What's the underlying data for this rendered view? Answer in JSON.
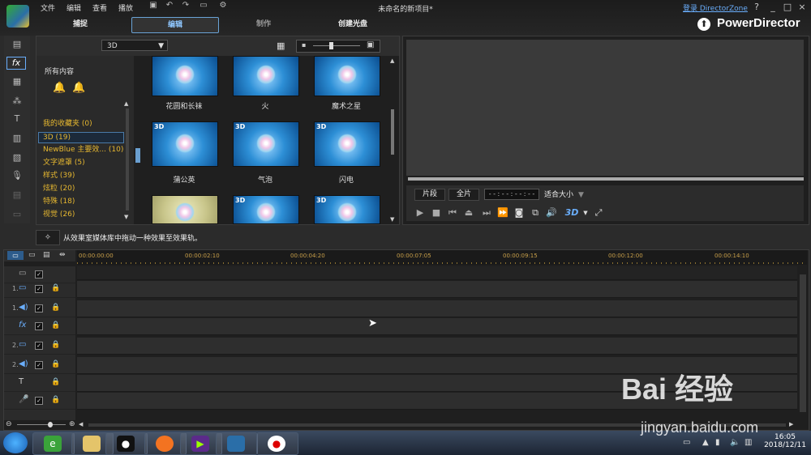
{
  "menu": [
    "文件",
    "编辑",
    "查看",
    "播放"
  ],
  "window": {
    "title": "未命名的新项目*",
    "login": "登录 DirectorZone",
    "help": "?",
    "minimize": "_",
    "maximize": "□",
    "close": "×"
  },
  "tabs": [
    "捕捉",
    "编辑",
    "制作",
    "创建光盘"
  ],
  "brand": "PowerDirector",
  "library": {
    "category_select": "3D",
    "tree_all": "所有内容",
    "tree_items": [
      "我的收藏夹 (0)",
      "3D (19)",
      "NewBlue 主要效... (10)",
      "文字遮罩 (5)",
      "样式 (39)",
      "炫粒 (20)",
      "特殊 (18)",
      "视觉 (26)"
    ],
    "effects": [
      {
        "label": "花圆和长袜",
        "tag": ""
      },
      {
        "label": "火",
        "tag": ""
      },
      {
        "label": "魔术之星",
        "tag": ""
      },
      {
        "label": "蒲公英",
        "tag": "3D"
      },
      {
        "label": "气泡",
        "tag": "3D"
      },
      {
        "label": "闪电",
        "tag": "3D"
      },
      {
        "label": "",
        "tag": "3D"
      },
      {
        "label": "",
        "tag": "3D"
      },
      {
        "label": "",
        "tag": "3D"
      }
    ]
  },
  "preview": {
    "clip": "片段",
    "full": "全片",
    "timecode": "- - : - - : - - : - -",
    "fit": "适合大小",
    "mode_3d": "3D"
  },
  "hint": "从效果室媒体库中拖动一种效果至效果轨。",
  "timeline": {
    "ruler": [
      "00:00:00:00",
      "00:00:02:10",
      "00:00:04:20",
      "00:00:07:05",
      "00:00:09:15",
      "00:00:12:00",
      "00:00:14:10"
    ],
    "tracks": [
      {
        "num": "",
        "icon": "▭"
      },
      {
        "num": "1.",
        "icon": "▭"
      },
      {
        "num": "1.",
        "icon": "◀)"
      },
      {
        "num": "",
        "icon": "fx"
      },
      {
        "num": "2.",
        "icon": "▭"
      },
      {
        "num": "2.",
        "icon": "◀)"
      },
      {
        "num": "",
        "icon": "T"
      },
      {
        "num": "",
        "icon": "🎤"
      }
    ]
  },
  "taskbar": {
    "time": "16:05",
    "date": "2018/12/11"
  },
  "watermark": {
    "text": "Bai 经验",
    "url": "jingyan.baidu.com"
  },
  "colors": {
    "accent": "#6aaefc",
    "folder": "#e7b830",
    "bg": "#1f1f1f"
  }
}
